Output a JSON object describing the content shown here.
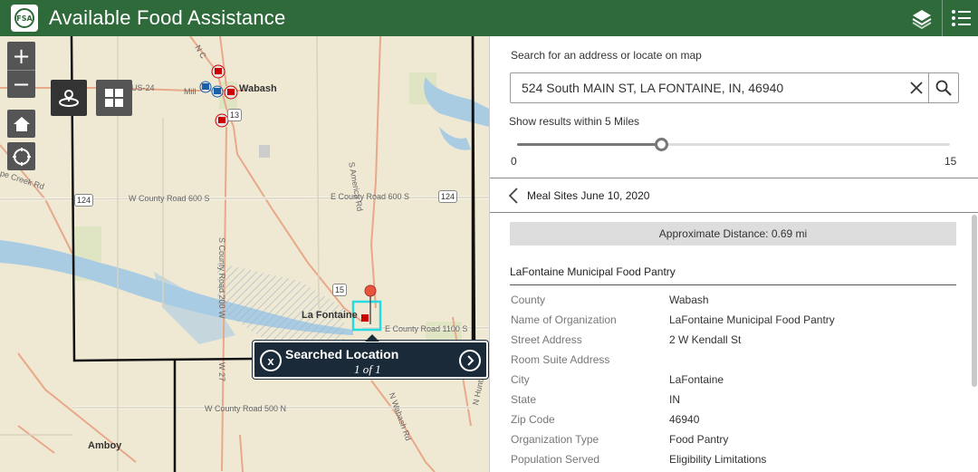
{
  "header": {
    "title": "Available Food Assistance",
    "logo_text": "FSA",
    "color": "#2e6a3a"
  },
  "map": {
    "zoom_in": "+",
    "zoom_out": "−",
    "towns": {
      "wabash": "Wabash",
      "lafontaine": "La Fontaine",
      "amboy": "Amboy"
    },
    "roads": {
      "w_county_600s": "W County Road 600 S",
      "e_county_600s": "E County Road 600 S",
      "e_county_1100s": "E County Road 1100 S",
      "w_county_500n": "W County Road 500 N",
      "s_america_rd": "S America Rd",
      "s_county_200w": "S County Road 200 W",
      "s_county_rd": "S County Road",
      "n_wabash_rd": "N Wabash Rd",
      "n_huntington": "N Huntington Rd",
      "us24": "US-24",
      "mill": "Mill",
      "n_c": "N C",
      "pe_creek": "pe Creek Rd",
      "w_27": "W 27"
    },
    "shields": {
      "s124a": "124",
      "s124b": "124",
      "s13": "13",
      "s15": "15"
    },
    "popup": {
      "title": "Searched Location",
      "count": "1 of 1",
      "close": "x",
      "next": "›"
    }
  },
  "panel": {
    "search_label": "Search for an address or locate on map",
    "search_value": "524 South MAIN ST, LA FONTAINE, IN, 46940",
    "radius_label": "Show results within 5 Miles",
    "slider": {
      "min": "0",
      "max": "15",
      "value": 5,
      "min_value": 0,
      "max_value": 15
    },
    "back_label": "Meal Sites June 10, 2020",
    "distance": "Approximate Distance: 0.69 mi",
    "site_name": "LaFontaine Municipal Food Pantry",
    "attributes": [
      {
        "key": "County",
        "value": "Wabash"
      },
      {
        "key": "Name of Organization",
        "value": "LaFontaine Municipal Food Pantry"
      },
      {
        "key": "Street Address",
        "value": "2 W Kendall St"
      },
      {
        "key": "Room Suite Address",
        "value": ""
      },
      {
        "key": "City",
        "value": "LaFontaine"
      },
      {
        "key": "State",
        "value": "IN"
      },
      {
        "key": "Zip Code",
        "value": "46940"
      },
      {
        "key": "Organization Type",
        "value": "Food Pantry"
      },
      {
        "key": "Population Served",
        "value": "Eligibility Limitations"
      }
    ]
  }
}
